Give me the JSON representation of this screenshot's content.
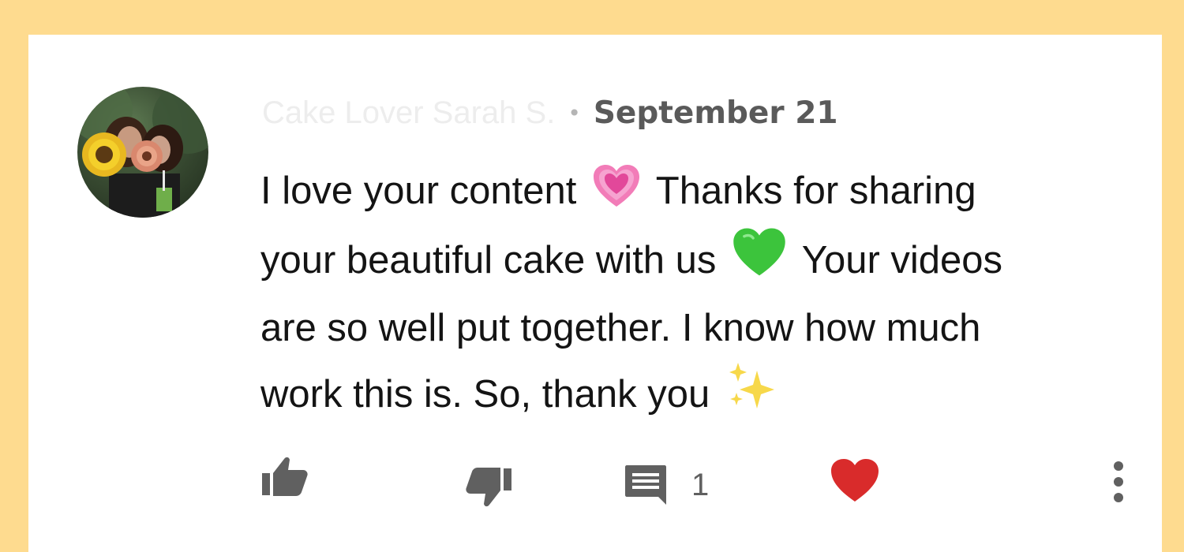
{
  "comment": {
    "author": "Cake Lover Sarah S.",
    "date": "September 21",
    "separator": "•",
    "text_line1": "I love your content",
    "text_line1b": "Thanks for sharing",
    "text_line2": "your beautiful cake with us",
    "text_line2b": "Your videos",
    "text_line3": "are so well put together. I know how much",
    "text_line4": "work this is. So, thank you",
    "emoji_1": "growing-heart-emoji",
    "emoji_2": "green-heart-emoji",
    "emoji_3": "sparkles-emoji"
  },
  "actions": {
    "reply_count": "1",
    "like_icon": "thumbs-up-icon",
    "dislike_icon": "thumbs-down-icon",
    "reply_icon": "comment-icon",
    "heart_icon": "creator-heart-icon",
    "more_icon": "more-vertical-icon"
  },
  "colors": {
    "background": "#fedb8f",
    "card": "#ffffff",
    "heart": "#d92b2b",
    "icon_gray": "#606060"
  }
}
